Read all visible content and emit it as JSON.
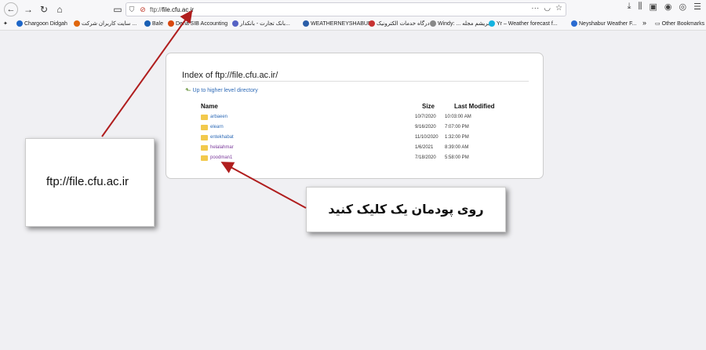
{
  "toolbar": {
    "url_prefix": "ftp://",
    "url_host": "file.cfu.ac.ir",
    "menu_dots": "···"
  },
  "bookmarks": [
    {
      "label": "Chargoon Didgah",
      "color": "#1e66c8"
    },
    {
      "label": "سایت کاربران شرکت ...",
      "color": "#e0660d"
    },
    {
      "label": "Bale",
      "color": "#1a5fb4"
    },
    {
      "label": "Dena SIB Accounting",
      "color": "#d9480f"
    },
    {
      "label": "بانک تجارت - بانکدار...",
      "color": "#5562c4"
    },
    {
      "label": "WEATHERNEYSHABUR",
      "color": "#2b5ea8"
    },
    {
      "label": "درگاه خدمات الکترونیک",
      "color": "#c73232"
    },
    {
      "label": "Windy: ... ابریشم مجله",
      "color": "#888888"
    },
    {
      "label": "Yr – Weather forecast f...",
      "color": "#14b3e0"
    },
    {
      "label": "Neyshabur Weather F...",
      "color": "#2a6bd1"
    },
    {
      "label": "Other Bookmarks",
      "color": "#777777"
    }
  ],
  "listing": {
    "title": "Index of ftp://file.cfu.ac.ir/",
    "up_link": "Up to higher level directory",
    "col_name": "Name",
    "col_size": "Size",
    "col_modified": "Last Modified",
    "rows": [
      {
        "name": "arbaeen",
        "date": "10/7/2020",
        "time": "10:03:00 AM"
      },
      {
        "name": "elearn",
        "date": "9/16/2020",
        "time": "7:07:00 PM"
      },
      {
        "name": "entekhabat",
        "date": "11/10/2020",
        "time": "1:32:00 PM"
      },
      {
        "name": "helalahmar",
        "date": "1/6/2021",
        "time": "8:39:00 AM"
      },
      {
        "name": "poodman1",
        "date": "7/18/2020",
        "time": "5:58:00 PM"
      }
    ]
  },
  "annotations": {
    "url_callout": "ftp://file.cfu.ac.ir",
    "click_callout": "روی پودمان یک کلیک کنید",
    "arrow_color": "#b01e1e"
  }
}
